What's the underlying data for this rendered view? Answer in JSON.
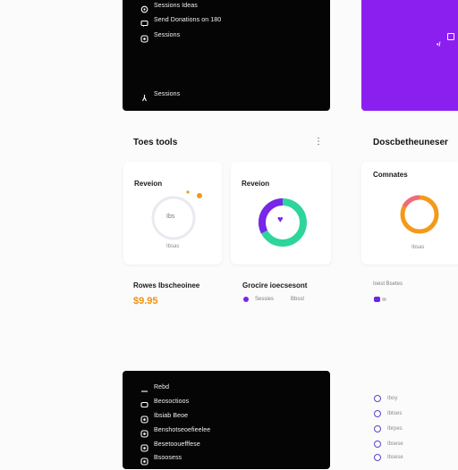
{
  "top_panel": {
    "menu_items": [
      {
        "icon": "settings-icon",
        "label": "Sessions Ideas"
      },
      {
        "icon": "message-icon",
        "label": "Send Donations on 180"
      },
      {
        "icon": "gear-icon",
        "label": "Sessions"
      }
    ],
    "footer_item": {
      "icon": "lamp-icon",
      "label": "Sessions"
    }
  },
  "right_top": {
    "label": "•/"
  },
  "section_left": {
    "title": "Toes tools",
    "more": "⋮"
  },
  "section_right": {
    "title": "Doscbetheuneser"
  },
  "cards": [
    {
      "title": "Reveion",
      "center": "Ibs",
      "caption": "Ibsas",
      "ring_color": "#e8e6ee",
      "dot_color": "#f09a1c"
    },
    {
      "title": "Reveion",
      "center": "♥",
      "caption": "",
      "ring_color": "#2ed59a",
      "accent": "#7a25e8"
    },
    {
      "title": "Comnates",
      "center": "",
      "caption": "Ibsas",
      "ring_color": "#f39a1a",
      "accent": "#f06a7a"
    }
  ],
  "stats": {
    "left": {
      "title": "Rowes Ibscheoinee",
      "value": "$9.95",
      "value_color": "#f0920f"
    },
    "middle": {
      "title": "Grocire ioecsesont",
      "legend": [
        {
          "label": "Sessies",
          "color": "#7a25e8"
        },
        {
          "label": "Bbsst",
          "color": "#cfcfcf"
        }
      ]
    },
    "right": {
      "title": "Ioest Bsetes",
      "color": "#6a25e8"
    }
  },
  "bottom_panel": {
    "menu_items": [
      {
        "icon": "minus-icon",
        "label": "Rebd"
      },
      {
        "icon": "message-icon",
        "label": "Beosoctioos"
      },
      {
        "icon": "gear-icon",
        "label": "Ibsiab Beoe"
      },
      {
        "icon": "gear-icon",
        "label": "Benshotseoefieelee"
      },
      {
        "icon": "gear-icon",
        "label": "Besetoouefffese"
      },
      {
        "icon": "gear-icon",
        "label": "Bsoosess"
      }
    ]
  },
  "right_list": [
    {
      "icon": "circle-icon",
      "label": "Iboy"
    },
    {
      "icon": "circle-icon",
      "label": "Ibtoes"
    },
    {
      "icon": "circle-icon",
      "label": "Ibrpes"
    },
    {
      "icon": "circle-icon",
      "label": "Ibsese"
    },
    {
      "icon": "circle-icon",
      "label": "Ibsese"
    }
  ]
}
